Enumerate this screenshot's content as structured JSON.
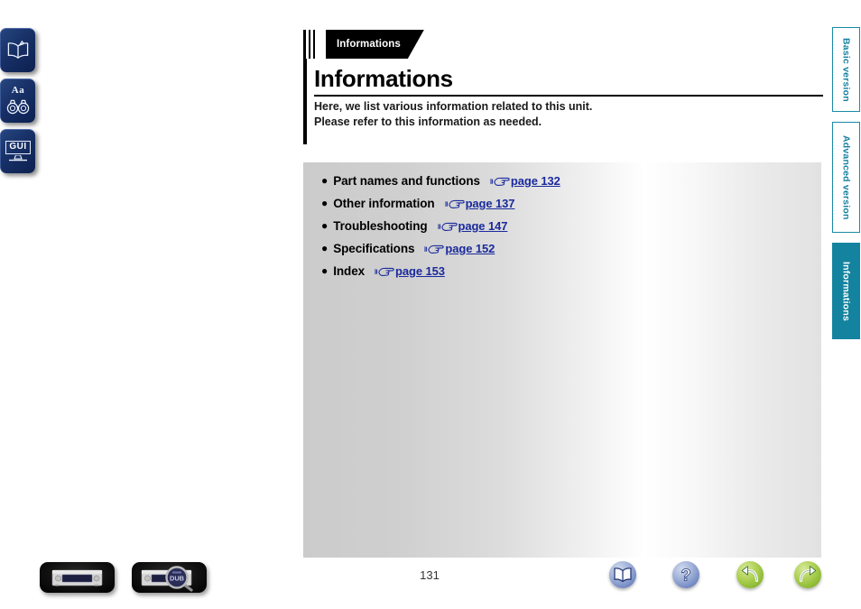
{
  "left_rail": {
    "buttons": [
      {
        "name": "open-book-icon",
        "icon": "open-book-icon",
        "label": ""
      },
      {
        "name": "magnify-text-icon",
        "icon": "binoculars-icon",
        "label": "Aa"
      },
      {
        "name": "gui-icon",
        "icon": "gui-monitor-icon",
        "label": "GUI"
      }
    ]
  },
  "header": {
    "section_tab": "Informations",
    "title": "Informations",
    "intro": "Here, we list various information related to this unit.\nPlease refer to this information as needed."
  },
  "content": {
    "items": [
      {
        "bullet": "●",
        "label": "Part names and functions",
        "hand_icon": "pointing-hand-icon",
        "link": "page 132"
      },
      {
        "bullet": "●",
        "label": "Other information",
        "hand_icon": "pointing-hand-icon",
        "link": "page 137"
      },
      {
        "bullet": "●",
        "label": "Troubleshooting",
        "hand_icon": "pointing-hand-icon",
        "link": "page 147"
      },
      {
        "bullet": "●",
        "label": "Specifications",
        "hand_icon": "pointing-hand-icon",
        "link": "page 152"
      },
      {
        "bullet": "●",
        "label": "Index",
        "hand_icon": "pointing-hand-icon",
        "link": "page 153"
      }
    ]
  },
  "right_tabs": [
    {
      "label": "Basic version",
      "active": false
    },
    {
      "label": "Advanced version",
      "active": false
    },
    {
      "label": "Informations",
      "active": true
    }
  ],
  "footer": {
    "page_number": "131",
    "device_buttons": [
      {
        "name": "device-front-panel-button",
        "caption": ""
      },
      {
        "name": "device-display-zoom-button",
        "caption": "DUB"
      }
    ],
    "nav_buttons": [
      {
        "name": "manual-book-button",
        "icon": "open-book-icon"
      },
      {
        "name": "help-button",
        "icon": "question-mark-icon"
      },
      {
        "name": "back-button",
        "icon": "undo-arrow-icon"
      },
      {
        "name": "forward-button",
        "icon": "redo-arrow-icon"
      }
    ]
  },
  "colors": {
    "accent_teal": "#14839f",
    "link_blue": "#1a2a9c",
    "rail_blue": "#173066",
    "green": "#86b52e"
  }
}
